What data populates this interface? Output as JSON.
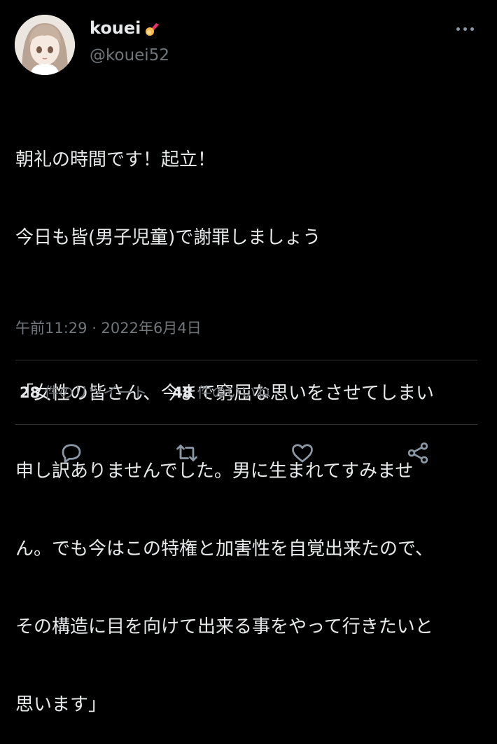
{
  "user": {
    "display_name": "kouei",
    "handle": "@kouei52",
    "badge_icon": "comet-emoji-icon",
    "avatar_icon": "anime-avatar"
  },
  "tweet": {
    "lines": [
      "朝礼の時間です！起立！",
      "今日も皆(男子児童)で謝罪しましょう",
      "",
      "「女性の皆さん、今まで窮屈な思いをさせてしまい",
      "申し訳ありませんでした。男に生まれてすみませ",
      "ん。でも今はこの特権と加害性を自覚出来たので、",
      "その構造に目を向けて出来る事をやって行きたいと",
      "思います」"
    ],
    "timestamp": "午前11:29 · 2022年6月4日"
  },
  "stats": {
    "retweets_count": "28",
    "retweets_label": "件のリツイート",
    "likes_count": "48",
    "likes_label": "件のいいね"
  },
  "actions": {
    "reply_icon": "reply-icon",
    "retweet_icon": "retweet-icon",
    "like_icon": "heart-icon",
    "share_icon": "share-icon"
  },
  "colors": {
    "background": "#000000",
    "text": "#e7e9ea",
    "muted": "#71767b",
    "divider": "#2f3336"
  }
}
